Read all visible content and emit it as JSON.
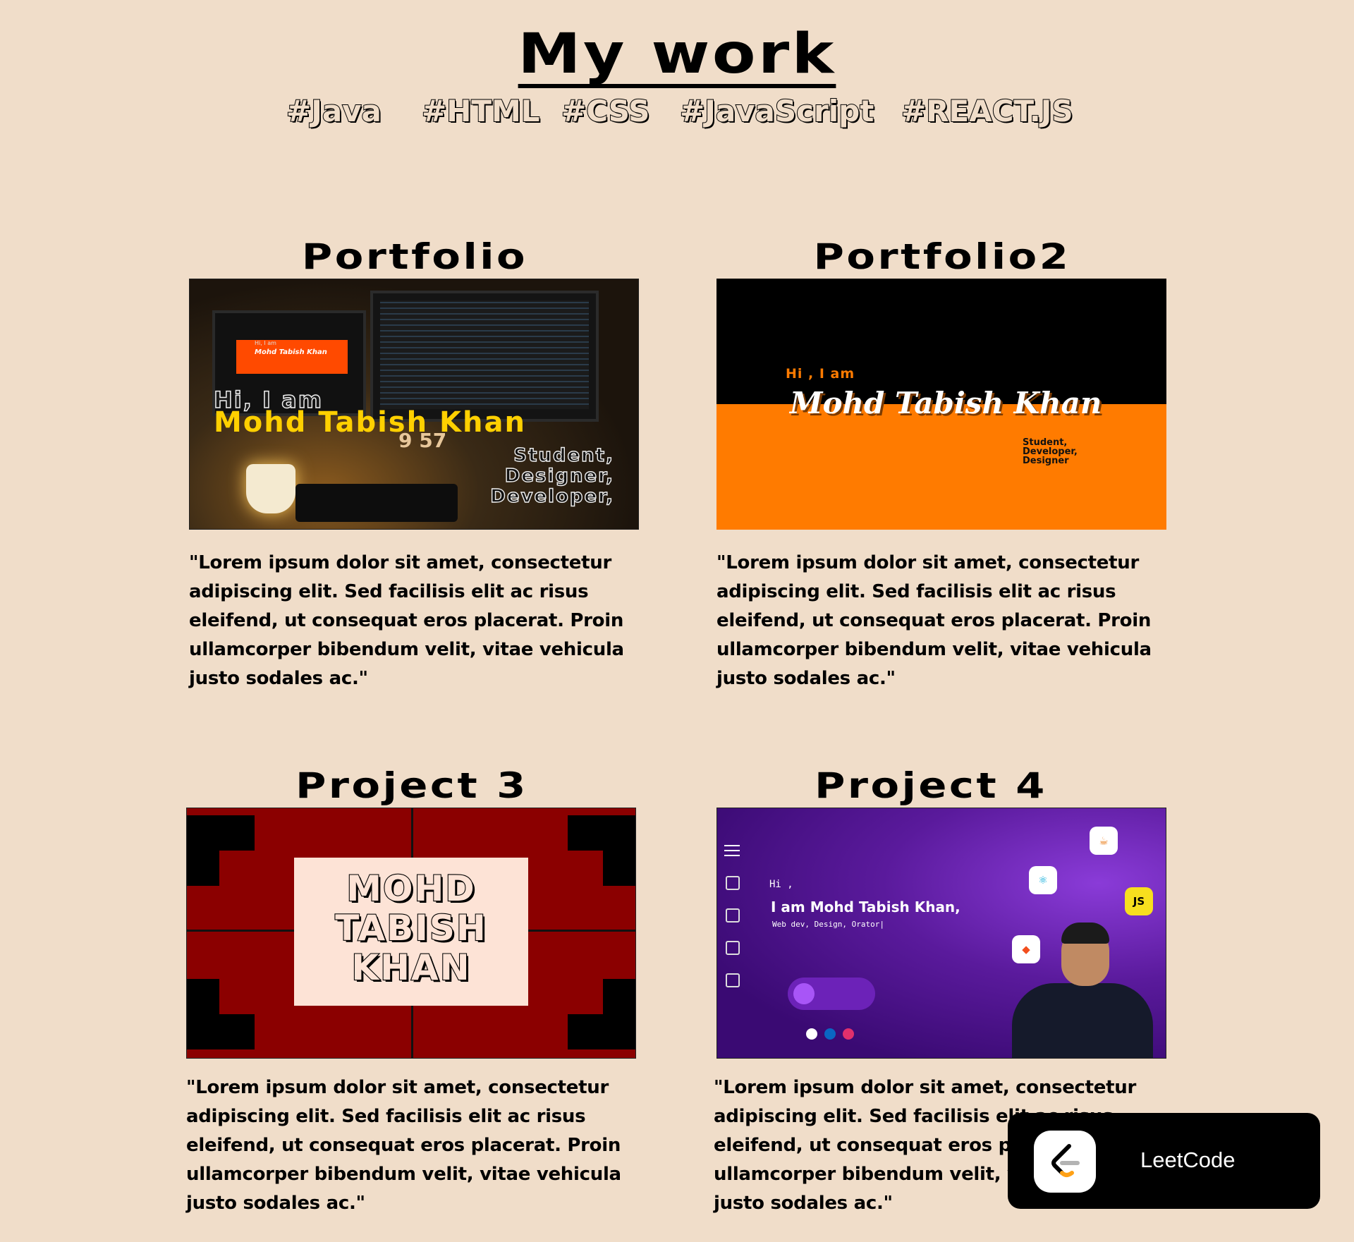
{
  "header": {
    "title": "My work",
    "tags": [
      "#Java",
      "#HTML",
      "#CSS",
      "#JavaScript",
      "#REACT.JS"
    ]
  },
  "projects": [
    {
      "title": "Portfolio",
      "description": "\"Lorem ipsum dolor sit amet, consectetur adipiscing elit. Sed facilisis elit ac risus eleifend, ut consequat eros placerat. Proin ullamcorper bibendum velit, vitae vehicula justo sodales ac.\"",
      "preview": {
        "greeting": "Hi, I am",
        "name": "Mohd Tabish Khan",
        "clock": "9 57",
        "roles": [
          "Student,",
          "Designer,",
          "Developer,"
        ],
        "mini_greeting": "Hi, I am",
        "mini_name": "Mohd Tabish Khan"
      }
    },
    {
      "title": "Portfolio2",
      "description": "\"Lorem ipsum dolor sit amet, consectetur adipiscing elit. Sed facilisis elit ac risus eleifend, ut consequat eros placerat. Proin ullamcorper bibendum velit, vitae vehicula justo sodales ac.\"",
      "preview": {
        "greeting": "Hi , I am",
        "name": "Mohd Tabish Khan",
        "roles": [
          "Student,",
          "Developer,",
          "Designer"
        ]
      }
    },
    {
      "title": "Project 3",
      "description": "\"Lorem ipsum dolor sit amet, consectetur adipiscing elit. Sed facilisis elit ac risus eleifend, ut consequat eros placerat. Proin ullamcorper bibendum velit, vitae vehicula justo sodales ac.\"",
      "preview": {
        "lines": [
          "MOHD",
          "TABISH",
          "KHAN"
        ]
      }
    },
    {
      "title": "Project 4",
      "description": "\"Lorem ipsum dolor sit amet, consectetur adipiscing elit. Sed facilisis elit ac risus eleifend, ut consequat eros placerat. Proin ullamcorper bibendum velit, vitae vehicula justo sodales ac.\"",
      "preview": {
        "greeting": "Hi ,",
        "name": "I am Mohd Tabish Khan,",
        "subtitle": "Web dev, Design, Orator|",
        "badge_js": "JS"
      }
    }
  ],
  "popup": {
    "label": "LeetCode"
  },
  "colors": {
    "background": "#f0ddc9",
    "orange": "#ff7b00",
    "dark_red": "#8b0000",
    "purple": "#5a1a9c"
  }
}
